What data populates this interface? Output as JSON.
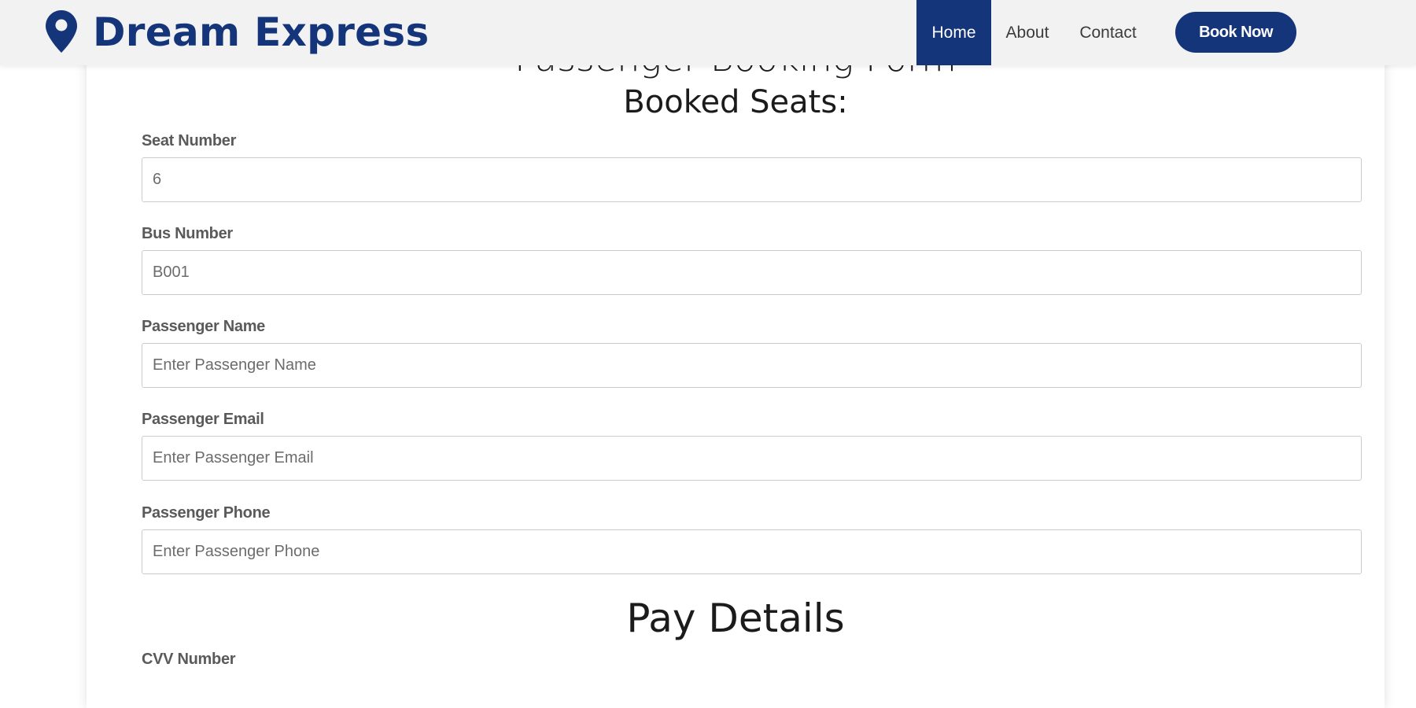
{
  "header": {
    "brand": "Dream Express",
    "logo_icon": "location-pin-icon",
    "nav": {
      "home": "Home",
      "about": "About",
      "contact": "Contact"
    },
    "book_now": "Book Now"
  },
  "form": {
    "title": "Passenger Booking Form",
    "booked_seats_label": "Booked Seats:",
    "fields": {
      "seat_number": {
        "label": "Seat Number",
        "value": "6"
      },
      "bus_number": {
        "label": "Bus Number",
        "value": "B001"
      },
      "passenger_name": {
        "label": "Passenger Name",
        "placeholder": "Enter Passenger Name"
      },
      "passenger_email": {
        "label": "Passenger Email",
        "placeholder": "Enter Passenger Email"
      },
      "passenger_phone": {
        "label": "Passenger Phone",
        "placeholder": "Enter Passenger Phone"
      }
    },
    "pay_details_title": "Pay Details",
    "cvv_label": "CVV Number"
  },
  "colors": {
    "brand": "#15357b",
    "header_bg": "#f2f2f2"
  }
}
